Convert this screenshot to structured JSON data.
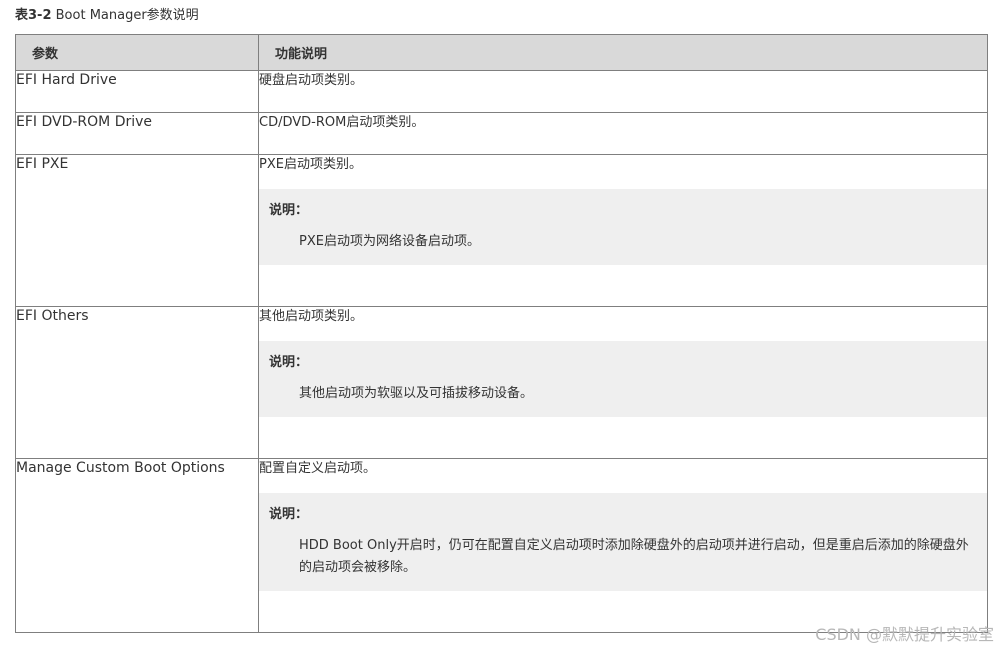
{
  "caption": {
    "number": "表3-2",
    "title": " Boot Manager参数说明"
  },
  "table": {
    "headers": [
      "参数",
      "功能说明"
    ],
    "rows": [
      {
        "param": "EFI Hard Drive",
        "desc": "硬盘启动项类别。"
      },
      {
        "param": "EFI DVD-ROM Drive",
        "desc": "CD/DVD-ROM启动项类别。"
      },
      {
        "param": "EFI PXE",
        "desc": "PXE启动项类别。",
        "note_title": "说明：",
        "note_body": "PXE启动项为网络设备启动项。"
      },
      {
        "param": "EFI Others",
        "desc": "其他启动项类别。",
        "note_title": "说明：",
        "note_body": "其他启动项为软驱以及可插拔移动设备。"
      },
      {
        "param": "Manage Custom Boot Options",
        "desc": "配置自定义启动项。",
        "note_title": "说明：",
        "note_body": "HDD Boot Only开启时，仍可在配置自定义启动项时添加除硬盘外的启动项并进行启动，但是重启后添加的除硬盘外的启动项会被移除。"
      }
    ]
  },
  "watermark": "CSDN @默默提升实验室"
}
